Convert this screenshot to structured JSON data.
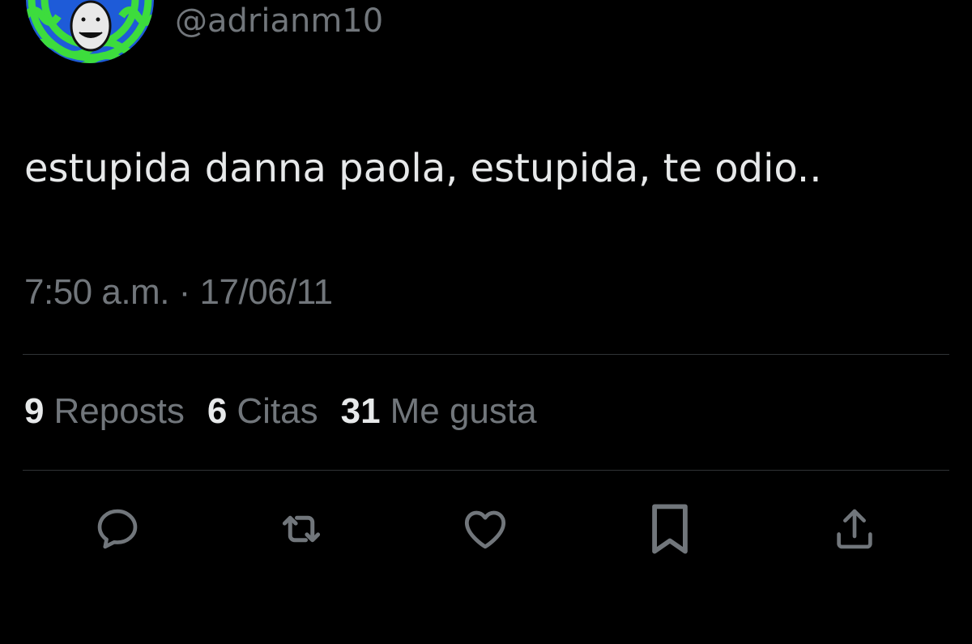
{
  "tweet": {
    "handle": "@adrianm10",
    "text": "estupida danna paola, estupida, te odio..",
    "timestamp": "7:50 a.m. · 17/06/11"
  },
  "stats": [
    {
      "count": "9",
      "label": "Reposts"
    },
    {
      "count": "6",
      "label": "Citas"
    },
    {
      "count": "31",
      "label": "Me gusta"
    }
  ],
  "actions": [
    {
      "icon": "reply-icon"
    },
    {
      "icon": "repost-icon"
    },
    {
      "icon": "like-icon"
    },
    {
      "icon": "bookmark-icon"
    },
    {
      "icon": "share-icon"
    }
  ],
  "colors": {
    "background": "#000000",
    "primary_text": "#e7e9ea",
    "secondary_text": "#71767b",
    "divider": "#2f3336",
    "avatar_green": "#3ddc3d",
    "avatar_blue": "#1e5bd8"
  }
}
